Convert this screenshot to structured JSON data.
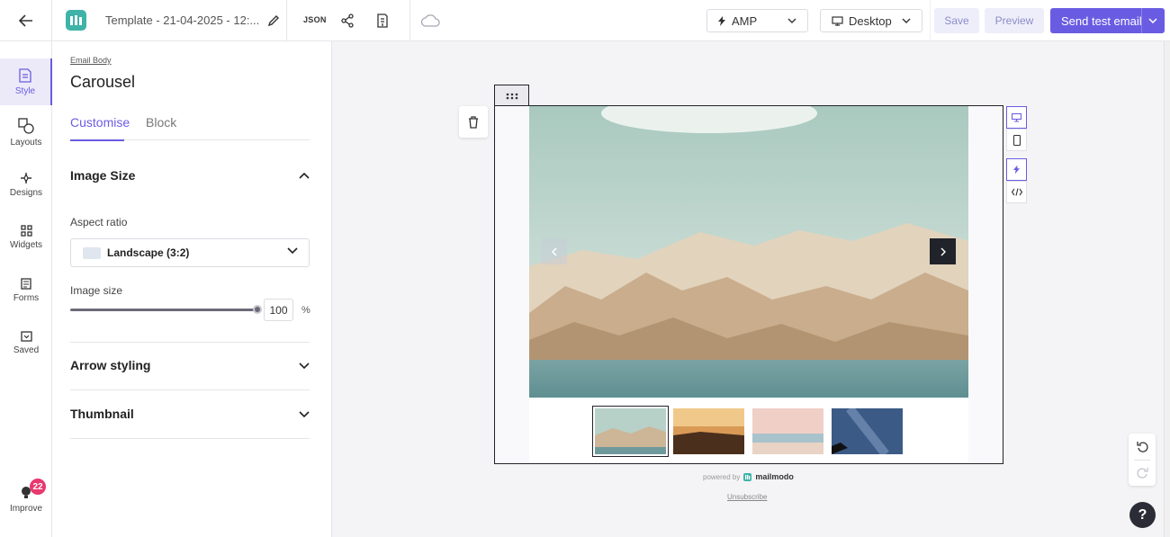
{
  "header": {
    "template_name": "Template - 21-04-2025 - 12:...",
    "json_label": "JSON",
    "amp_select": "AMP",
    "device_select": "Desktop",
    "save_label": "Save",
    "preview_label": "Preview",
    "send_test_label": "Send test email"
  },
  "rail": {
    "items": [
      {
        "label": "Style",
        "icon": "style-icon",
        "active": true
      },
      {
        "label": "Layouts",
        "icon": "layouts-icon"
      },
      {
        "label": "Designs",
        "icon": "designs-icon"
      },
      {
        "label": "Widgets",
        "icon": "widgets-icon"
      },
      {
        "label": "Forms",
        "icon": "forms-icon"
      },
      {
        "label": "Saved",
        "icon": "saved-icon"
      }
    ],
    "improve_label": "Improve",
    "improve_badge": "22"
  },
  "panel": {
    "breadcrumb": "Email Body",
    "title": "Carousel",
    "tabs": [
      "Customise",
      "Block"
    ],
    "active_tab": "Customise",
    "image_size_section": "Image Size",
    "aspect_ratio_label": "Aspect ratio",
    "aspect_ratio_value": "Landscape (3:2)",
    "image_size_label": "Image size",
    "image_size_value": "100",
    "image_size_unit": "%",
    "arrow_styling_section": "Arrow styling",
    "thumbnail_section": "Thumbnail"
  },
  "canvas": {
    "powered_by": "powered by",
    "brand": "mailmodo",
    "unsubscribe": "Unsubscribe",
    "thumbnails": [
      "lake-mountains",
      "sunset-field",
      "pink-beach",
      "starry-sky"
    ],
    "selected_thumbnail": 0
  },
  "colors": {
    "accent": "#6a5ce2",
    "badge": "#e8386e",
    "logo": "#3fb3a8"
  }
}
